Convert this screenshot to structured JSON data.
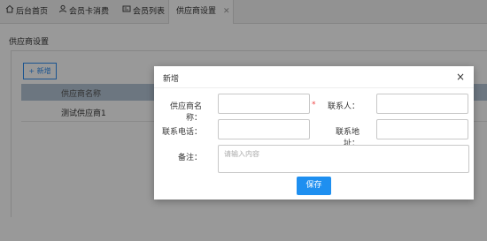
{
  "tabs": [
    {
      "label": "后台首页",
      "icon": "home-icon"
    },
    {
      "label": "会员卡消费",
      "icon": "user-icon"
    },
    {
      "label": "会员列表",
      "icon": "card-icon"
    },
    {
      "label": "供应商设置",
      "icon": "",
      "active": true
    }
  ],
  "page": {
    "title": "供应商设置",
    "add_label": "+ 新增",
    "column_header": "供应商名称",
    "rows": [
      "测试供应商1"
    ]
  },
  "modal": {
    "title": "新增",
    "close_label": "×",
    "fields": {
      "name_label": "供应商名称：",
      "contact_label": "联系人：",
      "phone_label": "联系电话：",
      "address_label": "联系地址：",
      "remark_label": "备注：",
      "remark_placeholder": "请输入内容",
      "required_mark": "*"
    },
    "save_label": "保存"
  },
  "colors": {
    "accent": "#1e8ff0",
    "required": "#e44444"
  }
}
